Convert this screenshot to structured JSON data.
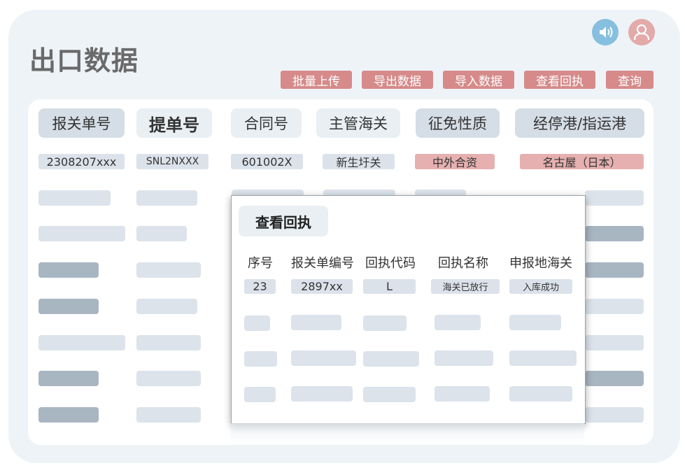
{
  "page": {
    "title": "出口数据"
  },
  "header_icons": {
    "speaker": "speaker-icon",
    "user": "user-icon"
  },
  "toolbar": {
    "buttons": [
      "批量上传",
      "导出数据",
      "导入数据",
      "查看回执",
      "查询"
    ]
  },
  "table": {
    "columns": [
      "报关单号",
      "提单号",
      "合同号",
      "主管海关",
      "征免性质",
      "经停港/指运港"
    ],
    "first_row": [
      "2308207xxx",
      "SNL2NXXX",
      "601002X",
      "新生圩关",
      "中外合资",
      "名古屋（日本）"
    ]
  },
  "modal": {
    "title": "查看回执",
    "columns": [
      "序号",
      "报关单编号",
      "回执代码",
      "回执名称",
      "申报地海关"
    ],
    "first_row": [
      "23",
      "2897xx",
      "L",
      "海关已放行",
      "入库成功"
    ]
  },
  "colors": {
    "accent_button": "#d68a8a",
    "highlight_cell": "#e6b0b0",
    "speaker_icon_bg": "#86bfdf",
    "user_icon_bg": "#e4a9a9"
  }
}
